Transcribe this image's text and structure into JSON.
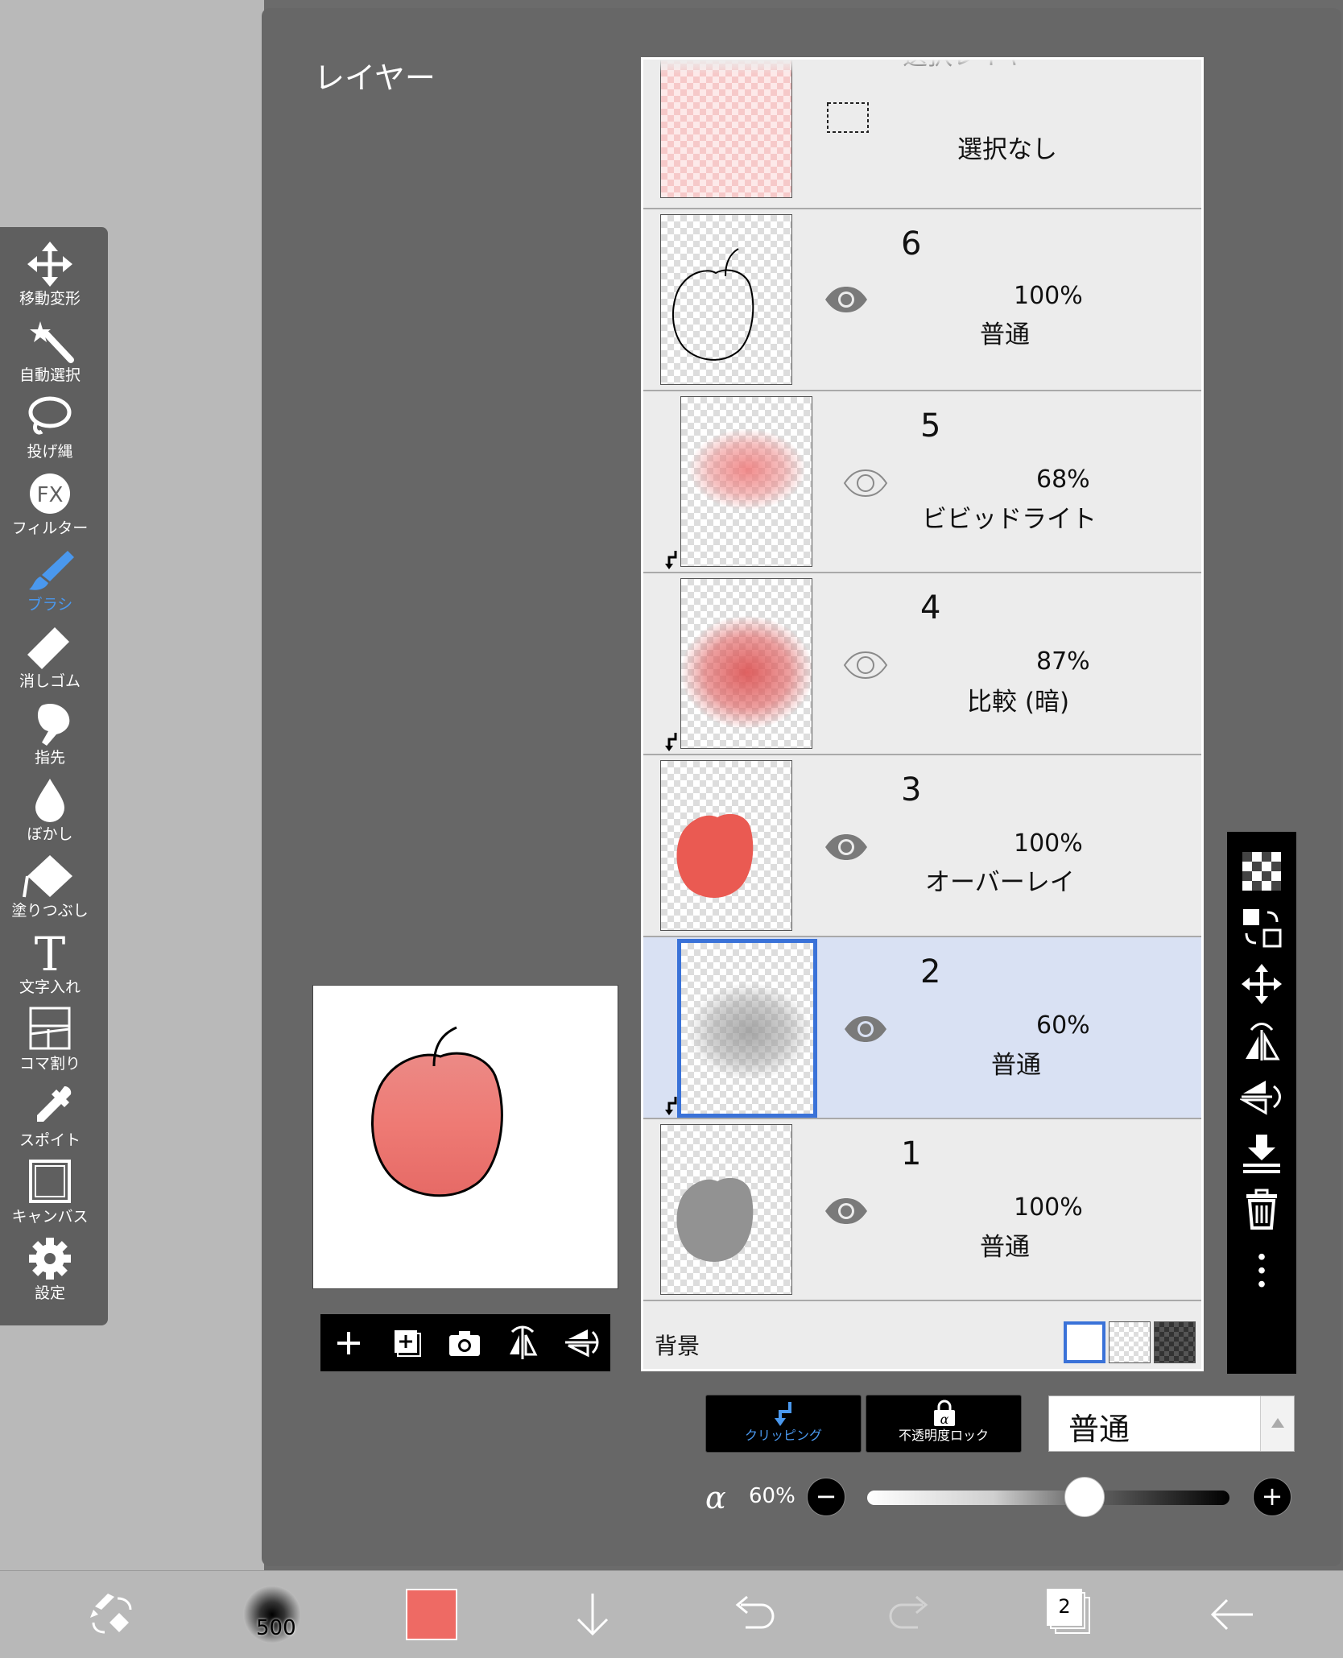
{
  "panel": {
    "title": "レイヤー"
  },
  "tools": [
    {
      "name": "move-transform",
      "label": "移動変形",
      "icon": "move-arrows-icon"
    },
    {
      "name": "auto-select",
      "label": "自動選択",
      "icon": "magic-wand-icon"
    },
    {
      "name": "lasso",
      "label": "投げ縄",
      "icon": "lasso-icon"
    },
    {
      "name": "filter",
      "label": "フィルター",
      "icon": "fx-icon"
    },
    {
      "name": "brush",
      "label": "ブラシ",
      "icon": "brush-icon",
      "active": true
    },
    {
      "name": "eraser",
      "label": "消しゴム",
      "icon": "eraser-icon"
    },
    {
      "name": "finger",
      "label": "指先",
      "icon": "finger-icon"
    },
    {
      "name": "blur",
      "label": "ぼかし",
      "icon": "drop-icon"
    },
    {
      "name": "fill",
      "label": "塗りつぶし",
      "icon": "fill-bucket-icon"
    },
    {
      "name": "text",
      "label": "文字入れ",
      "icon": "text-icon"
    },
    {
      "name": "frame-divider",
      "label": "コマ割り",
      "icon": "frame-divider-icon"
    },
    {
      "name": "eyedropper",
      "label": "スポイト",
      "icon": "eyedropper-icon"
    },
    {
      "name": "canvas",
      "label": "キャンバス",
      "icon": "canvas-icon"
    },
    {
      "name": "settings",
      "label": "設定",
      "icon": "gear-icon"
    }
  ],
  "selection_layer": {
    "title": "選択レイヤ",
    "status": "選択なし"
  },
  "layers": [
    {
      "number": "6",
      "opacity": "100%",
      "mode": "普通",
      "visible": true,
      "clipped": false,
      "selected": false
    },
    {
      "number": "5",
      "opacity": "68%",
      "mode": "ビビッドライト",
      "visible": true,
      "clipped": true,
      "selected": false
    },
    {
      "number": "4",
      "opacity": "87%",
      "mode": "比較 (暗)",
      "visible": true,
      "clipped": true,
      "selected": false
    },
    {
      "number": "3",
      "opacity": "100%",
      "mode": "オーバーレイ",
      "visible": true,
      "clipped": false,
      "selected": false
    },
    {
      "number": "2",
      "opacity": "60%",
      "mode": "普通",
      "visible": true,
      "clipped": true,
      "selected": true
    },
    {
      "number": "1",
      "opacity": "100%",
      "mode": "普通",
      "visible": true,
      "clipped": false,
      "selected": false
    }
  ],
  "background": {
    "label": "背景",
    "options": [
      "white",
      "transparent",
      "dark-checker"
    ],
    "selected": "white"
  },
  "clipping": {
    "label": "クリッピング",
    "color": "#4a98ee"
  },
  "alpha_lock": {
    "label": "不透明度ロック"
  },
  "blend_mode": {
    "value": "普通"
  },
  "opacity": {
    "symbol": "α",
    "value": "60%",
    "fraction": 0.6
  },
  "brush": {
    "size": "500"
  },
  "current_color": "#ee6a64",
  "layer_count": "2",
  "colors": {
    "accent": "#3a72d8",
    "selected_row": "#d9e1f3"
  }
}
